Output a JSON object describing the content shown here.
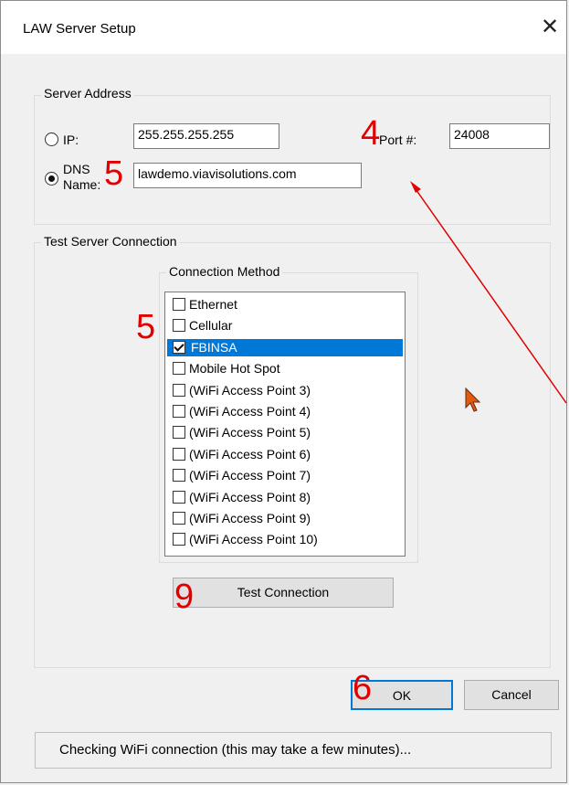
{
  "window": {
    "title": "LAW Server Setup",
    "close_glyph": "✕"
  },
  "server_address": {
    "group_label": "Server Address",
    "ip_label": "IP:",
    "ip_value": "255.255.255.255",
    "port_label": "Port #:",
    "port_value": "24008",
    "dns_label_line1": "DNS",
    "dns_label_line2": "Name:",
    "dns_value": "lawdemo.viavisolutions.com",
    "selected": "dns"
  },
  "test_connection": {
    "group_label": "Test Server Connection",
    "method_label": "Connection Method",
    "items": [
      {
        "label": "Ethernet",
        "checked": false,
        "selected": false
      },
      {
        "label": "Cellular",
        "checked": false,
        "selected": false
      },
      {
        "label": "FBINSA",
        "checked": true,
        "selected": true
      },
      {
        "label": "Mobile Hot Spot",
        "checked": false,
        "selected": false
      },
      {
        "label": "(WiFi Access Point 3)",
        "checked": false,
        "selected": false
      },
      {
        "label": "(WiFi Access Point 4)",
        "checked": false,
        "selected": false
      },
      {
        "label": "(WiFi Access Point 5)",
        "checked": false,
        "selected": false
      },
      {
        "label": "(WiFi Access Point 6)",
        "checked": false,
        "selected": false
      },
      {
        "label": "(WiFi Access Point 7)",
        "checked": false,
        "selected": false
      },
      {
        "label": "(WiFi Access Point 8)",
        "checked": false,
        "selected": false
      },
      {
        "label": "(WiFi Access Point 9)",
        "checked": false,
        "selected": false
      },
      {
        "label": "(WiFi Access Point 10)",
        "checked": false,
        "selected": false
      }
    ],
    "test_button_label": "Test Connection"
  },
  "buttons": {
    "ok_label": "OK",
    "cancel_label": "Cancel"
  },
  "status": {
    "text": "Checking WiFi connection (this may take a few minutes)..."
  },
  "annotations": {
    "num_port": "4",
    "num_dns": "5",
    "num_list": "5",
    "num_test": "9",
    "num_ok": "6",
    "color": "#e00000"
  },
  "colors": {
    "selection": "#0078d7",
    "annotation_arrow": "#e00000",
    "cursor": "#e05a10"
  }
}
